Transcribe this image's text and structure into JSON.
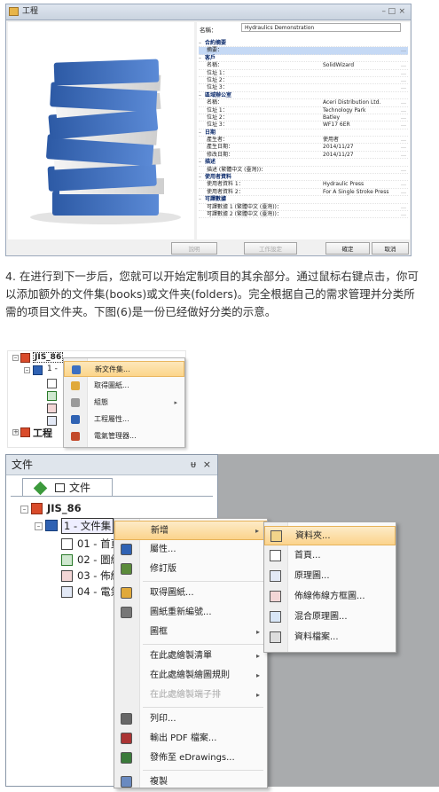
{
  "window": {
    "title": "工程",
    "controls": [
      "–",
      "□",
      "×"
    ],
    "name_label": "名稱：",
    "name_value": "Hydraulics Demonstration",
    "properties": [
      {
        "type": "group",
        "label": "合約摘要"
      },
      {
        "type": "field",
        "key": "摘要：",
        "value": "",
        "sel": true
      },
      {
        "type": "group",
        "label": "客戶"
      },
      {
        "type": "field",
        "key": "名稱：",
        "value": "SolidWizard"
      },
      {
        "type": "field",
        "key": "位址 1：",
        "value": ""
      },
      {
        "type": "field",
        "key": "位址 2：",
        "value": ""
      },
      {
        "type": "field",
        "key": "位址 3：",
        "value": ""
      },
      {
        "type": "group",
        "label": "區域辦公室"
      },
      {
        "type": "field",
        "key": "名稱：",
        "value": "Aceri Distribution Ltd."
      },
      {
        "type": "field",
        "key": "位址 1：",
        "value": "Technology Park"
      },
      {
        "type": "field",
        "key": "位址 2：",
        "value": "Batley"
      },
      {
        "type": "field",
        "key": "位址 3：",
        "value": "WF17 6ER"
      },
      {
        "type": "group",
        "label": "日期"
      },
      {
        "type": "field",
        "key": "產生者：",
        "value": "使用者"
      },
      {
        "type": "field",
        "key": "產生日期：",
        "value": "2014/11/27"
      },
      {
        "type": "field",
        "key": "修改日期：",
        "value": "2014/11/27"
      },
      {
        "type": "group",
        "label": "描述"
      },
      {
        "type": "field",
        "key": "描述 (繁體中文 (臺灣))：",
        "value": ""
      },
      {
        "type": "group",
        "label": "使用者資料"
      },
      {
        "type": "field",
        "key": "使用者資料 1：",
        "value": "Hydraulic Press"
      },
      {
        "type": "field",
        "key": "使用者資料 2：",
        "value": "For A Single Stroke Press"
      },
      {
        "type": "group",
        "label": "可譯數據"
      },
      {
        "type": "field",
        "key": "可譯數據 1 (繁體中文 (臺灣))：",
        "value": ""
      },
      {
        "type": "field",
        "key": "可譯數據 2 (繁體中文 (臺灣))：",
        "value": ""
      }
    ],
    "buttons": {
      "help": "說明",
      "reset": "工作設定",
      "ok": "確定",
      "cancel": "取消"
    }
  },
  "paragraph": "4. 在进行到下一步后，您就可以开始定制项目的其余部分。通过鼠标右键点击，你可以添加额外的文件集(books)或文件夹(folders)。完全根据自己的需求管理并分类所需的项目文件夹。下图(6)是一份已经做好分类的示意。",
  "tree1": {
    "root": "JIS_86",
    "child": "1 -",
    "second_root": "工程",
    "menu": [
      {
        "label": "新文件集...",
        "hl": true
      },
      {
        "label": "取得圖紙..."
      },
      {
        "label": "組態",
        "arrow": "▸"
      },
      {
        "label": "工程屬性..."
      },
      {
        "label": "電氣管理器..."
      }
    ]
  },
  "panel": {
    "header": "文件",
    "pin": "ᵾ",
    "close": "×",
    "tab": "文件",
    "tree": {
      "root": "JIS_86",
      "book": "1 - 文件集",
      "docs": [
        "01 - 首頁",
        "02 - 圖紙",
        "03 - 佈線",
        "04 - 電氣"
      ]
    }
  },
  "menu2": [
    {
      "label": "新增",
      "arrow": "▸",
      "hl": true
    },
    {
      "label": "屬性..."
    },
    {
      "label": "修訂版"
    },
    {
      "sep": true
    },
    {
      "label": "取得圖紙..."
    },
    {
      "label": "圖紙重新編號..."
    },
    {
      "label": "圖框",
      "arrow": "▸"
    },
    {
      "sep": true
    },
    {
      "label": "在此處繪製清單",
      "arrow": "▸"
    },
    {
      "label": "在此處繪製繪圖規則",
      "arrow": "▸"
    },
    {
      "label": "在此處繪製端子排",
      "arrow": "▸",
      "dis": true
    },
    {
      "sep": true
    },
    {
      "label": "列印..."
    },
    {
      "label": "輸出 PDF 檔案..."
    },
    {
      "label": "發佈至 eDrawings..."
    },
    {
      "sep": true
    },
    {
      "label": "複製"
    }
  ],
  "submenu": [
    {
      "label": "資料夾...",
      "hl": true
    },
    {
      "label": "首頁..."
    },
    {
      "label": "原理圖..."
    },
    {
      "label": "佈線佈線方框圖..."
    },
    {
      "label": "混合原理圖..."
    },
    {
      "label": "資料檔案..."
    }
  ],
  "colors": {
    "accent": "#2b5aa8",
    "highlight": "#fcd58a",
    "binder": "#3a6fc0"
  }
}
